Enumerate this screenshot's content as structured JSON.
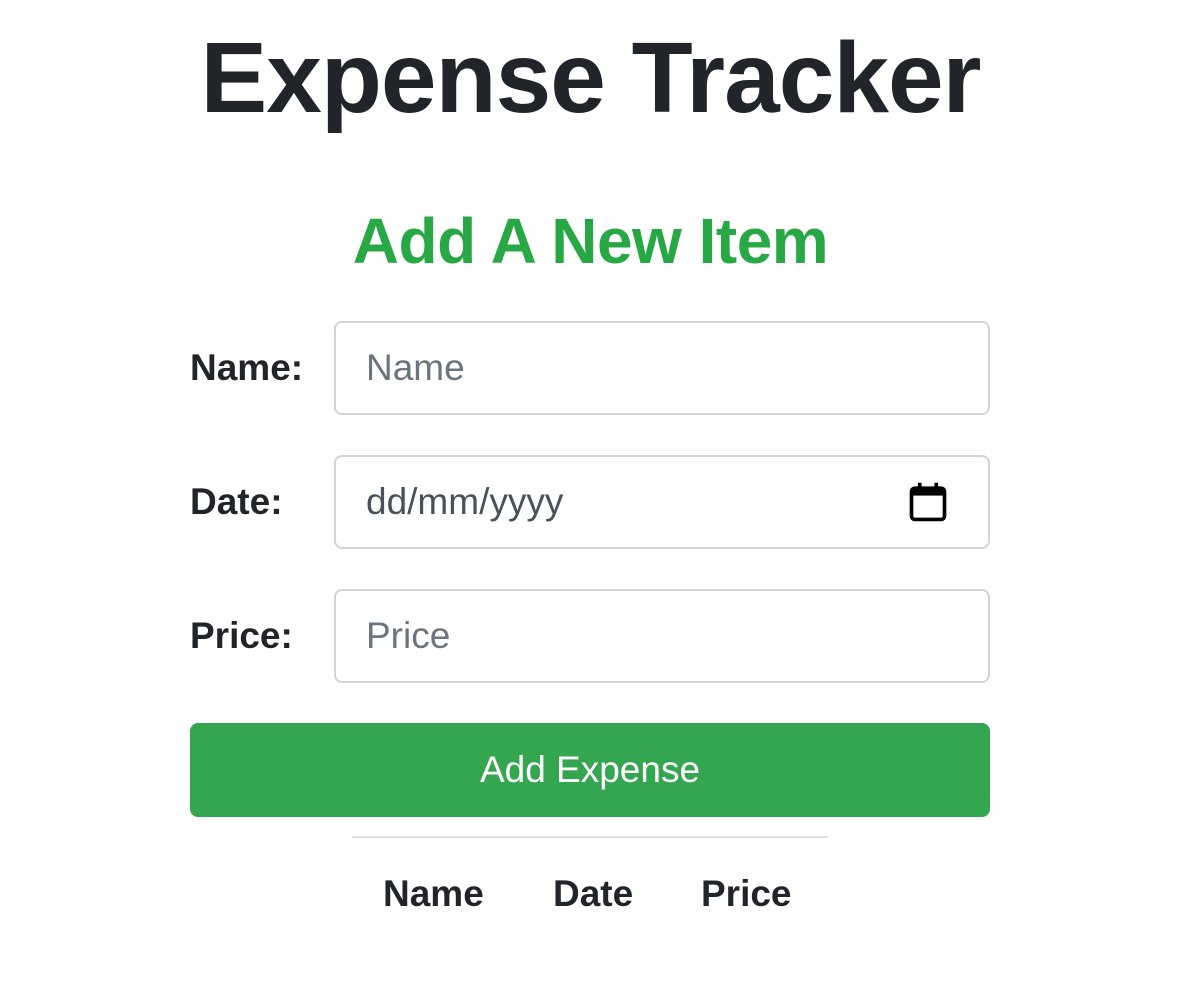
{
  "app": {
    "title": "Expense Tracker"
  },
  "form": {
    "heading": "Add A New Item",
    "name": {
      "label": "Name:",
      "value": "",
      "placeholder": "Name"
    },
    "date": {
      "label": "Date:",
      "value": "",
      "placeholder": "dd/mm/yyyy",
      "icon": "calendar-icon"
    },
    "price": {
      "label": "Price:",
      "value": "",
      "placeholder": "Price"
    },
    "submit_label": "Add Expense"
  },
  "table": {
    "columns": [
      "Name",
      "Date",
      "Price"
    ],
    "rows": []
  },
  "colors": {
    "heading_green": "#28a745",
    "button_green": "#33a64f",
    "button_text": "#ffffff",
    "text_dark": "#212529",
    "border": "#ced4da"
  }
}
